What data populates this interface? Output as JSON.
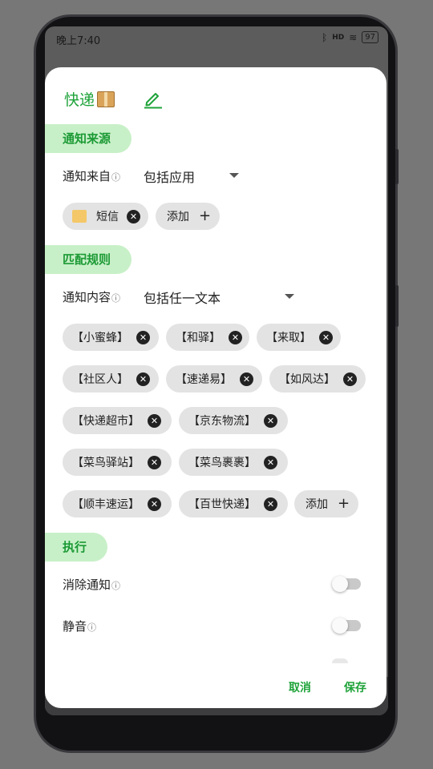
{
  "status_bar": {
    "time": "晚上7:40",
    "bluetooth_icon": "bluetooth-icon",
    "signal_text": "HD",
    "wifi_icon": "wifi-icon",
    "battery": "97"
  },
  "dialog": {
    "title": "快递",
    "sections": {
      "source": "通知来源",
      "match": "匹配规则",
      "execute": "执行"
    },
    "source": {
      "label": "通知来自",
      "mode": "包括应用",
      "apps": [
        "短信"
      ],
      "add_label": "添加"
    },
    "match": {
      "label": "通知内容",
      "mode": "包括任一文本",
      "keywords": [
        "【小蜜蜂】",
        "【和驿】",
        "【来取】",
        "【社区人】",
        "【速递易】",
        "【如风达】",
        "【快递超市】",
        "【京东物流】",
        "【菜鸟驿站】",
        "【菜鸟裹裹】",
        "【顺丰速运】",
        "【百世快递】"
      ],
      "add_label": "添加"
    },
    "actions": [
      {
        "label": "消除通知",
        "enabled": false
      },
      {
        "label": "静音",
        "enabled": false
      }
    ],
    "buttons": {
      "cancel": "取消",
      "save": "保存"
    },
    "colors": {
      "accent": "#1fa33a",
      "section_bg": "#c8f0c8"
    }
  }
}
